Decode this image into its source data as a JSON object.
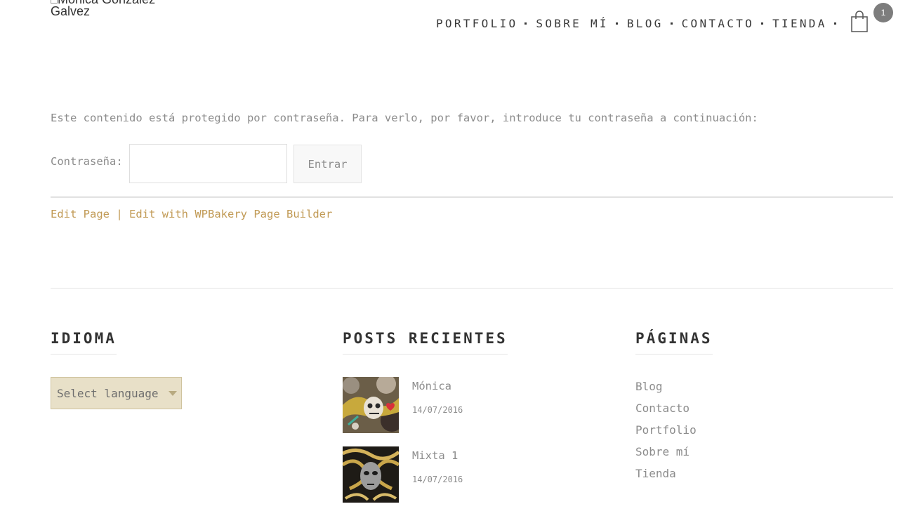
{
  "header": {
    "logo_alt": "Mónica González Galvez",
    "nav": [
      {
        "label": "PORTFOLIO"
      },
      {
        "label": "SOBRE MÍ"
      },
      {
        "label": "BLOG"
      },
      {
        "label": "CONTACTO"
      },
      {
        "label": "TIENDA"
      }
    ],
    "cart_count": "1"
  },
  "content": {
    "protected_message": "Este contenido está protegido por contraseña. Para verlo, por favor, introduce tu contraseña a continuación:",
    "password_label": "Contraseña:",
    "password_value": "",
    "submit_label": "Entrar",
    "edit_page_label": "Edit Page",
    "edit_separator": "|",
    "edit_wpbakery_label": "Edit with WPBakery Page Builder"
  },
  "footer": {
    "language_widget": {
      "title": "IDIOMA",
      "select_value": "Select language"
    },
    "recent_posts_widget": {
      "title": "POSTS RECIENTES",
      "posts": [
        {
          "title": "Mónica",
          "date": "14/07/2016",
          "thumb_icon": "skull-artwork-thumbnail"
        },
        {
          "title": "Mixta 1",
          "date": "14/07/2016",
          "thumb_icon": "mask-artwork-thumbnail"
        }
      ]
    },
    "pages_widget": {
      "title": "PÁGINAS",
      "links": [
        "Blog",
        "Contacto",
        "Portfolio",
        "Sobre mí",
        "Tienda"
      ]
    }
  },
  "colors": {
    "accent_link": "#c19a55",
    "select_bg": "#e8e0c8",
    "badge_bg": "#7d7d7d",
    "text_muted": "#8c8c8c",
    "heading": "#333333"
  }
}
